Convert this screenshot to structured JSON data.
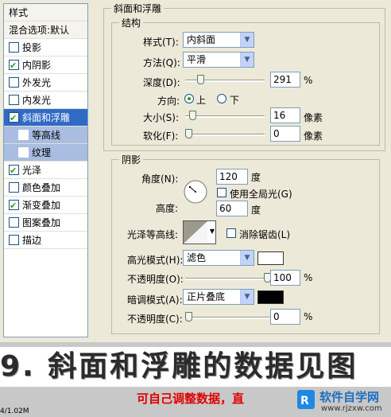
{
  "styles_panel": {
    "header": "样式",
    "blend": "混合选项:默认",
    "items": [
      {
        "label": "投影",
        "checked": false
      },
      {
        "label": "内阴影",
        "checked": true
      },
      {
        "label": "外发光",
        "checked": false
      },
      {
        "label": "内发光",
        "checked": false
      },
      {
        "label": "斜面和浮雕",
        "checked": true,
        "selected": true
      },
      {
        "label": "等高线",
        "checked": false,
        "sub": true
      },
      {
        "label": "纹理",
        "checked": false,
        "sub": true
      },
      {
        "label": "光泽",
        "checked": true
      },
      {
        "label": "颜色叠加",
        "checked": false
      },
      {
        "label": "渐变叠加",
        "checked": true
      },
      {
        "label": "图案叠加",
        "checked": false
      },
      {
        "label": "描边",
        "checked": false
      }
    ]
  },
  "bevel": {
    "title": "斜面和浮雕",
    "structure_title": "结构",
    "style_label": "样式(T):",
    "style_value": "内斜面",
    "method_label": "方法(Q):",
    "method_value": "平滑",
    "depth_label": "深度(D):",
    "depth_value": "291",
    "depth_unit": "%",
    "depth_level_percent": 17,
    "direction_label": "方向:",
    "dir_up": "上",
    "dir_down": "下",
    "size_label": "大小(S):",
    "size_value": "16",
    "size_unit": "像素",
    "size_level_percent": 6,
    "soften_label": "软化(F):",
    "soften_value": "0",
    "soften_unit": "像素",
    "soften_level_percent": 0
  },
  "shading": {
    "title": "阴影",
    "angle_label": "角度(N):",
    "angle_value": "120",
    "angle_unit": "度",
    "global_light_label": "使用全局光(G)",
    "altitude_label": "高度:",
    "altitude_value": "60",
    "altitude_unit": "度",
    "gloss_label": "光泽等高线:",
    "antialias_label": "消除锯齿(L)",
    "highlight_label": "高光模式(H):",
    "highlight_value": "滤色",
    "highlight_color": "#ffffff",
    "opacity1_label": "不透明度(O):",
    "opacity1_value": "100",
    "opacity1_unit": "%",
    "opacity1_level_percent": 100,
    "shadow_label": "暗调模式(A):",
    "shadow_value": "正片叠底",
    "shadow_color": "#000000",
    "opacity2_label": "不透明度(C):",
    "opacity2_value": "0",
    "opacity2_unit": "%",
    "opacity2_level_percent": 0
  },
  "caption": {
    "title": "9. 斜面和浮雕的数据见图",
    "subtitle": "可自己调整数据，直",
    "status": "4/1.02M",
    "watermark_brand": "软件自学网",
    "watermark_url": "www.rjzxw.com"
  }
}
